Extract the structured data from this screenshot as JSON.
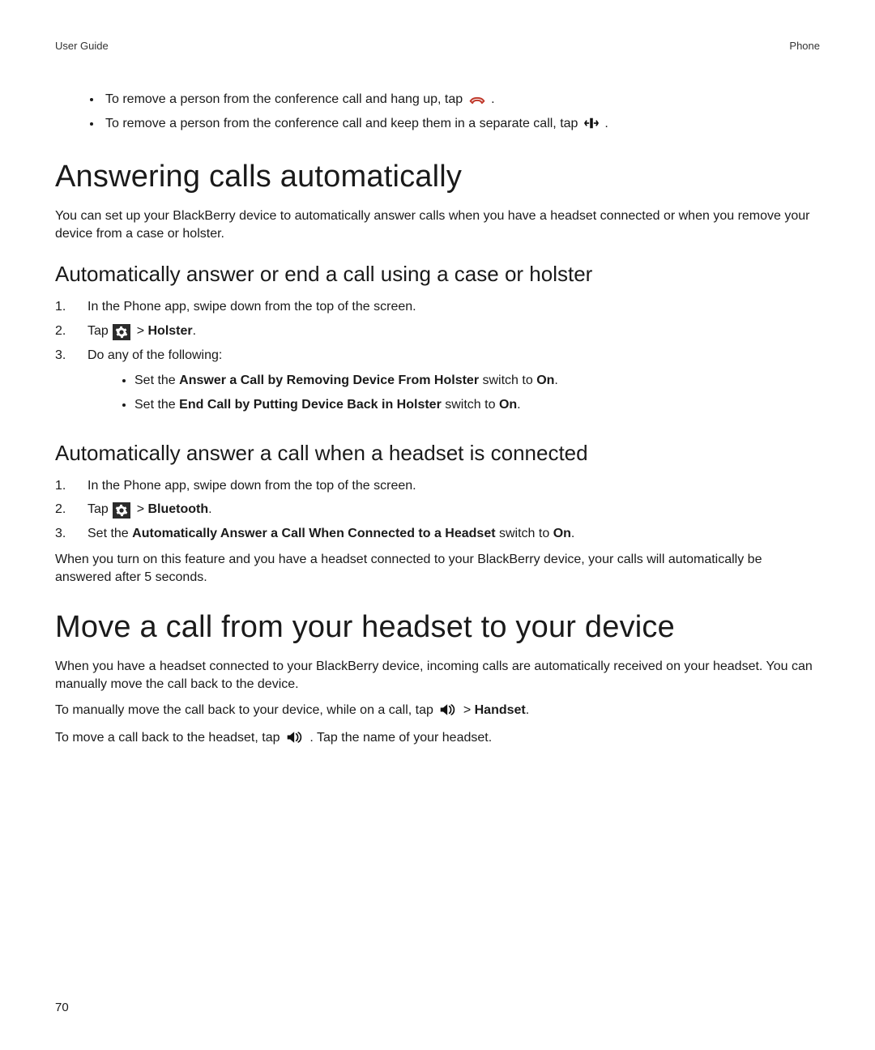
{
  "header": {
    "left": "User Guide",
    "right": "Phone"
  },
  "intro_bullets": {
    "b1a": "To remove a person from the conference call and hang up, tap ",
    "b1b": " .",
    "b2a": "To remove a person from the conference call and keep them in a separate call, tap ",
    "b2b": " ."
  },
  "h1_1": "Answering calls automatically",
  "p1": "You can set up your BlackBerry device to automatically answer calls when you have a headset connected or when you remove your device from a case or holster.",
  "h2_1": "Automatically answer or end a call using a case or holster",
  "steps1": {
    "s1_num": "1.",
    "s1": "In the Phone app, swipe down from the top of the screen.",
    "s2_num": "2.",
    "s2_a": "Tap ",
    "s2_b": " > ",
    "s2_c": "Holster",
    "s2_d": ".",
    "s3_num": "3.",
    "s3": "Do any of the following:",
    "s3_b1_a": "Set the ",
    "s3_b1_b": "Answer a Call by Removing Device From Holster",
    "s3_b1_c": " switch to ",
    "s3_b1_d": "On",
    "s3_b1_e": ".",
    "s3_b2_a": "Set the ",
    "s3_b2_b": "End Call by Putting Device Back in Holster",
    "s3_b2_c": " switch to ",
    "s3_b2_d": "On",
    "s3_b2_e": "."
  },
  "h2_2": "Automatically answer a call when a headset is connected",
  "steps2": {
    "s1_num": "1.",
    "s1": "In the Phone app, swipe down from the top of the screen.",
    "s2_num": "2.",
    "s2_a": "Tap ",
    "s2_b": " > ",
    "s2_c": "Bluetooth",
    "s2_d": ".",
    "s3_num": "3.",
    "s3_a": "Set the ",
    "s3_b": "Automatically Answer a Call When Connected to a Headset",
    "s3_c": " switch to ",
    "s3_d": "On",
    "s3_e": "."
  },
  "p2": "When you turn on this feature and you have a headset connected to your BlackBerry device, your calls will automatically be answered after 5 seconds.",
  "h1_2": "Move a call from your headset to your device",
  "p3": "When you have a headset connected to your BlackBerry device, incoming calls are automatically received on your headset. You can manually move the call back to the device.",
  "p4_a": "To manually move the call back to your device, while on a call, tap ",
  "p4_b": " > ",
  "p4_c": "Handset",
  "p4_d": ".",
  "p5_a": "To move a call back to the headset, tap ",
  "p5_b": " . Tap the name of your headset.",
  "page_number": "70"
}
